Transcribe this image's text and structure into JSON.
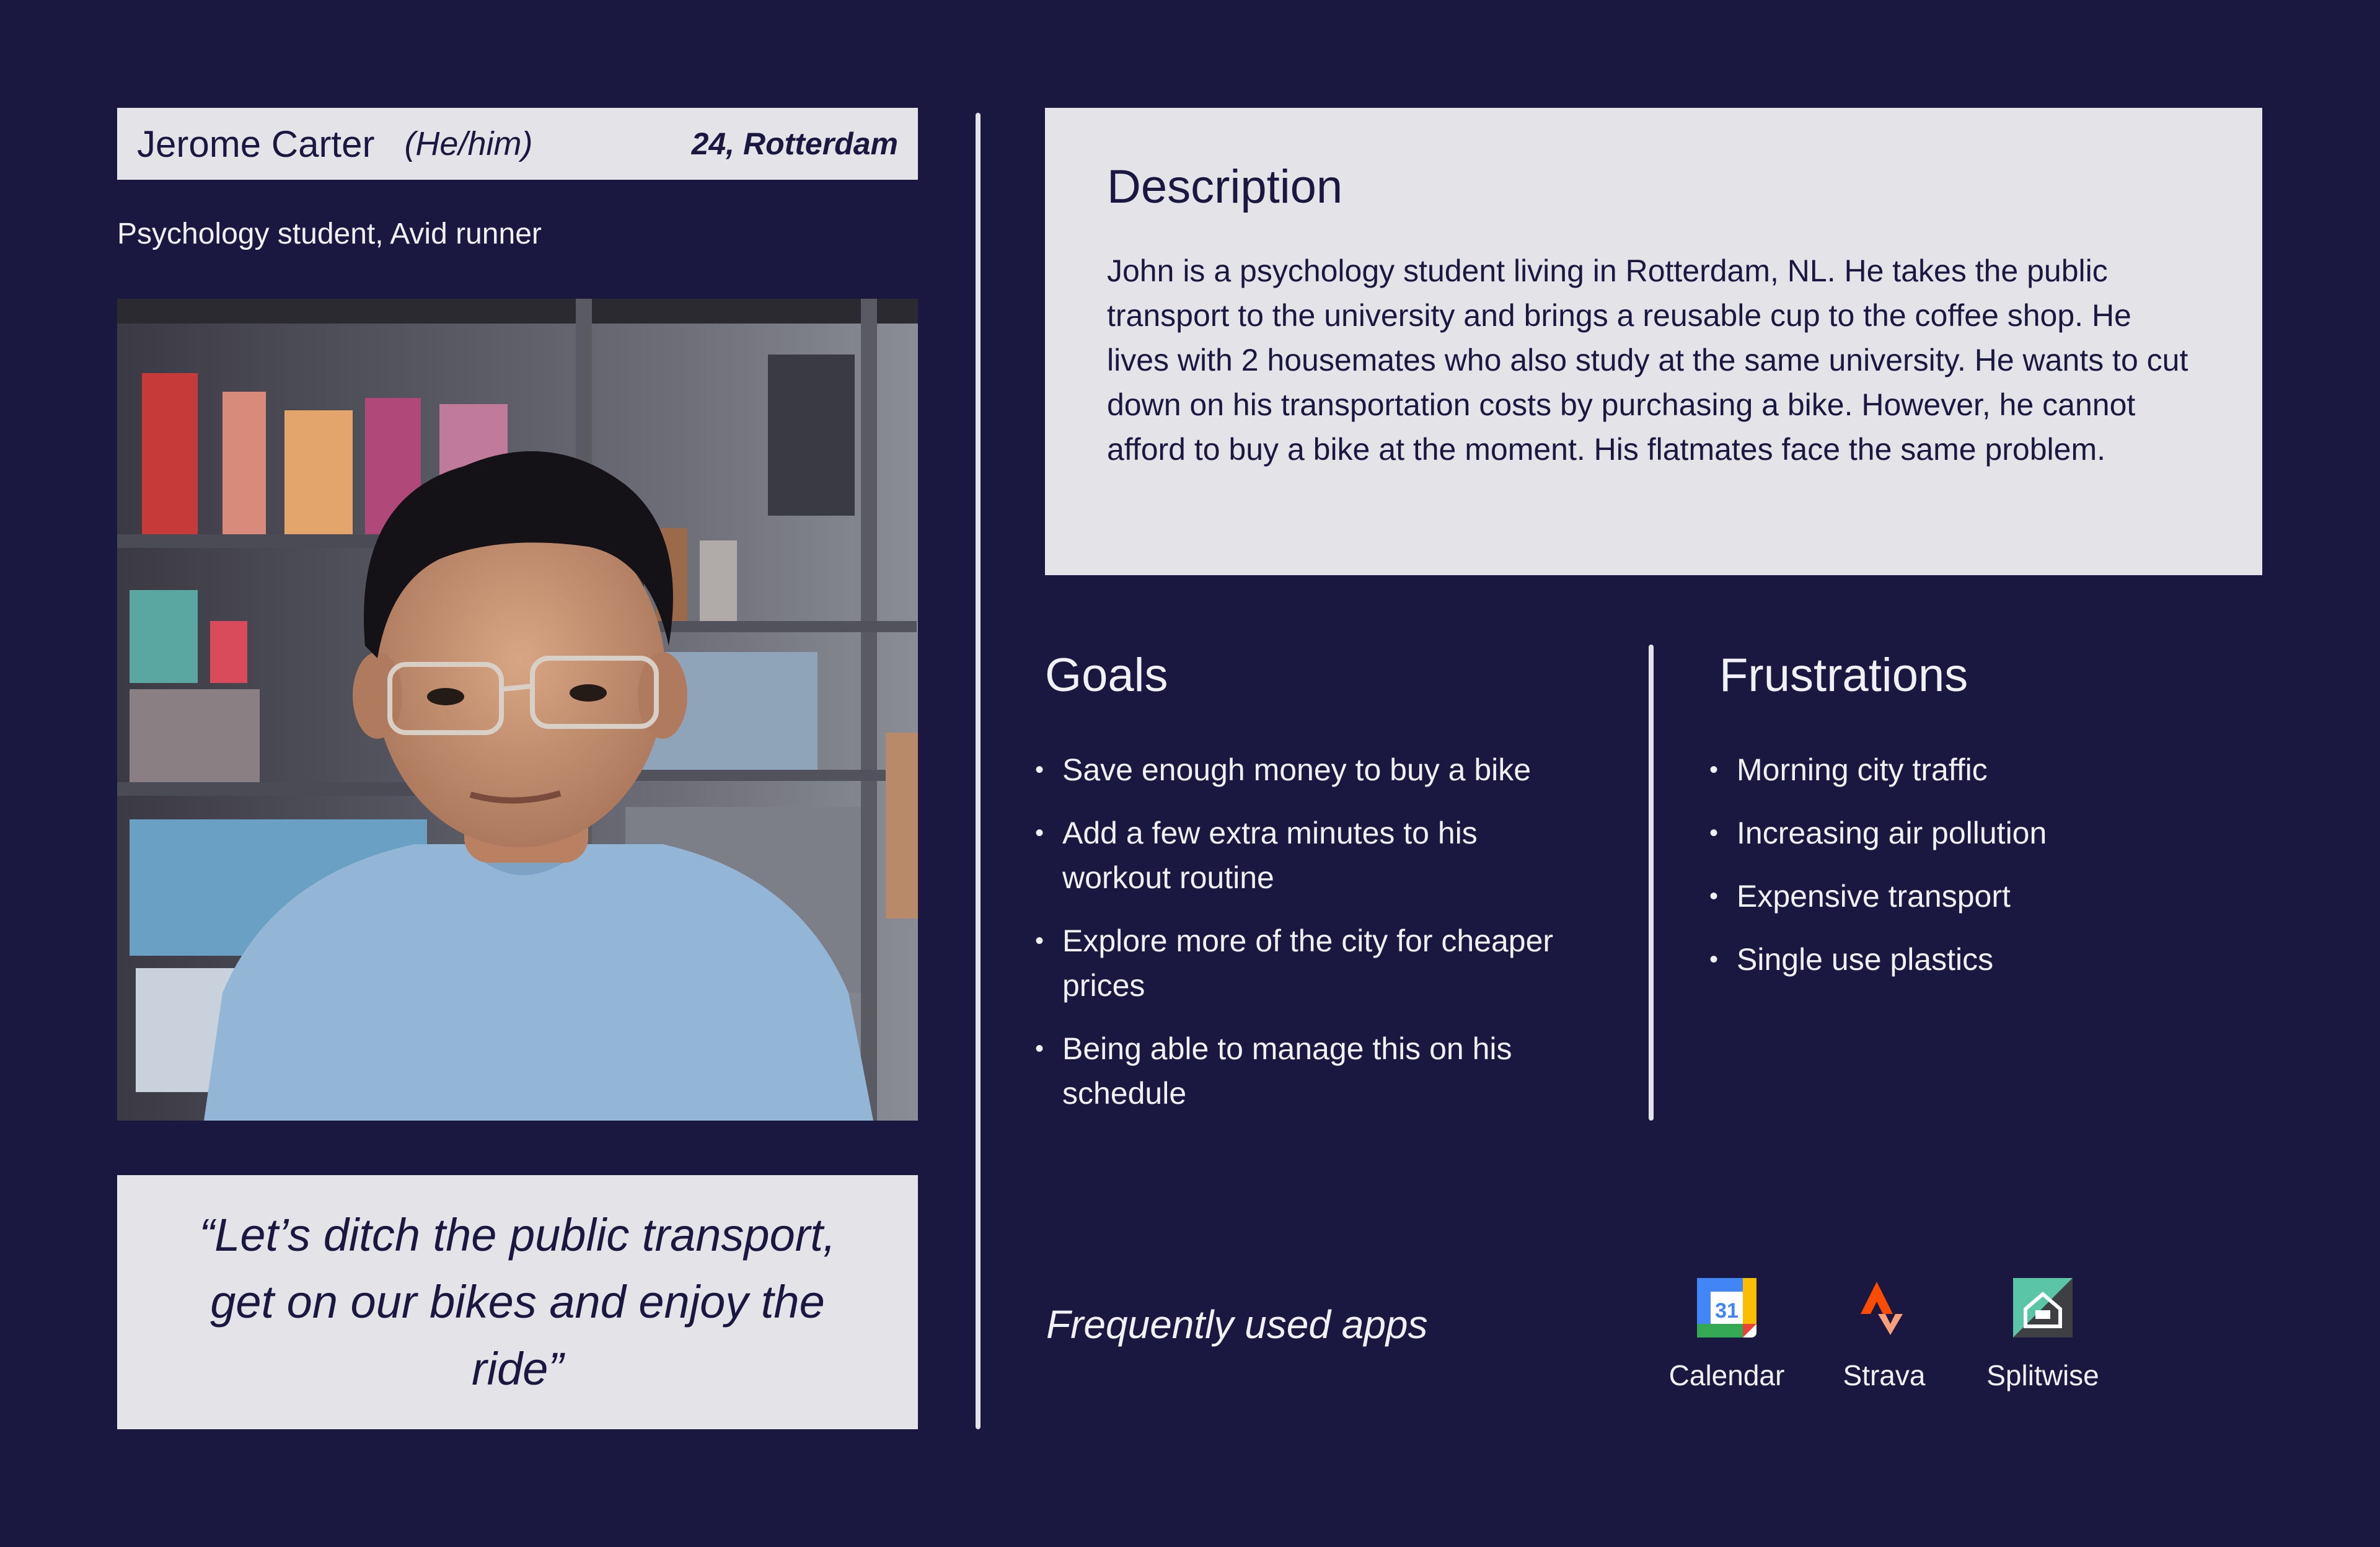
{
  "persona": {
    "name": "Jerome Carter",
    "pronouns": "(He/him)",
    "age_location": "24, Rotterdam",
    "subtitle": "Psychology student, Avid runner",
    "photo_description_icon": "portrait-photo",
    "quote": "“Let’s ditch the public transport, get on our bikes and enjoy the ride”"
  },
  "description": {
    "title": "Description",
    "text": "John is a psychology student living in Rotterdam, NL. He takes the public transport to the university and brings a reusable cup to the coffee shop. He lives with 2 housemates who also study at the same university. He wants to cut down on his transportation costs by purchasing a bike. However, he cannot afford to buy a bike at the moment. His flatmates face the same problem."
  },
  "goals": {
    "title": "Goals",
    "items": [
      "Save enough money to buy a bike",
      "Add a few extra minutes to his workout routine",
      "Explore more of the city for cheaper prices",
      "Being able to manage this on his schedule"
    ]
  },
  "frustrations": {
    "title": "Frustrations",
    "items": [
      "Morning city traffic",
      "Increasing air pollution",
      "Expensive transport",
      "Single use plastics"
    ]
  },
  "apps": {
    "heading": "Frequently used apps",
    "items": [
      {
        "label": "Calendar",
        "icon": "google-calendar-icon",
        "badge": "31"
      },
      {
        "label": "Strava",
        "icon": "strava-icon"
      },
      {
        "label": "Splitwise",
        "icon": "splitwise-icon"
      }
    ]
  },
  "colors": {
    "background": "#1a1840",
    "panel": "#e3e3e8",
    "text_dark": "#1a1840",
    "text_light": "#f1f1f5",
    "strava_orange": "#fc4c02",
    "splitwise_green": "#5bc5a7"
  }
}
